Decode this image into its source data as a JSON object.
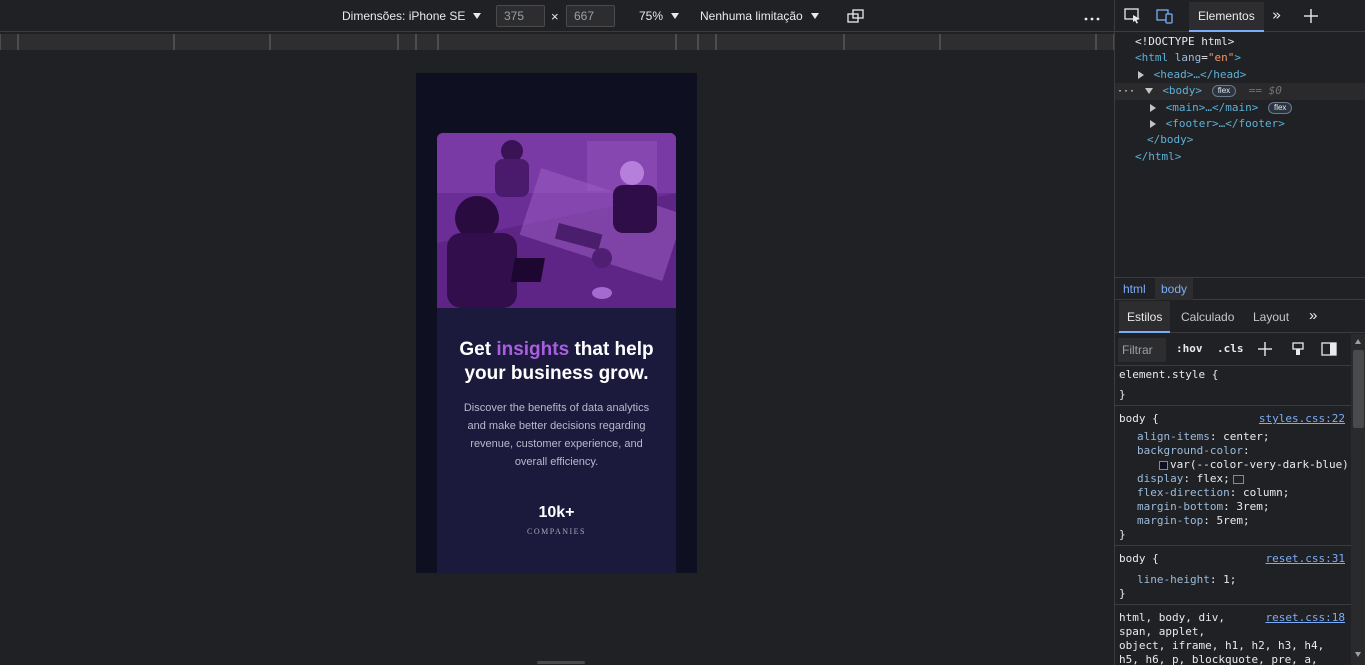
{
  "device_toolbar": {
    "dimensions_label": "Dimensões: iPhone SE",
    "width_value": "375",
    "times_symbol": "×",
    "height_value": "667",
    "zoom": "75%",
    "throttling": "Nenhuma limitação",
    "more": "⋮"
  },
  "page": {
    "title_before": "Get",
    "title_accent": "insights",
    "title_after": "that help your business grow.",
    "description": "Discover the benefits of data analytics and make better decisions regarding revenue, customer experience, and overall efficiency.",
    "stat_value": "10k+",
    "stat_label": "COMPANIES",
    "accent_color": "#a95ee0",
    "background_color": "#0e0f21",
    "card_color": "#1c1a3c"
  },
  "devtools": {
    "active_tab": "Elementos",
    "dom": {
      "doctype": "<!DOCTYPE html>",
      "html_open_tag": "<html",
      "html_attr_name": "lang",
      "html_attr_value": "\"en\"",
      "html_close_bracket": ">",
      "head": "<head>…</head>",
      "body_open": "<body>",
      "flex_badge": "flex",
      "dollar": "== $0",
      "main": "<main>…</main>",
      "footer": "<footer>…</footer>",
      "body_close": "</body>",
      "html_close": "</html>",
      "ellipsis": "···"
    },
    "breadcrumbs": [
      "html",
      "body"
    ],
    "sub_tabs": [
      "Estilos",
      "Calculado",
      "Layout"
    ],
    "filter_placeholder": "Filtrar",
    "hov": ":hov",
    "cls": ".cls",
    "styles": {
      "element_style_open": "element.style {",
      "close_brace": "}",
      "rule1": {
        "selector": "body {",
        "source": "styles.css:22",
        "decls": [
          {
            "prop": "align-items",
            "val": "center;"
          },
          {
            "prop": "background-color",
            "val": ""
          },
          {
            "prop": "",
            "val": "var(--color-very-dark-blue)"
          },
          {
            "prop": "display",
            "val": "flex;"
          },
          {
            "prop": "flex-direction",
            "val": "column;"
          },
          {
            "prop": "margin-bottom",
            "val": "3rem;"
          },
          {
            "prop": "margin-top",
            "val": "5rem;"
          }
        ]
      },
      "rule2": {
        "selector": "body {",
        "source": "reset.css:31",
        "decls": [
          {
            "prop": "line-height",
            "val": "1;"
          }
        ]
      },
      "rule3": {
        "selector_lines": [
          "html, body, div,",
          "span, applet,",
          "object, iframe, h1, h2, h3, h4,",
          "h5, h6, p, blockquote, pre, a,"
        ],
        "source": "reset.css:18"
      }
    }
  }
}
